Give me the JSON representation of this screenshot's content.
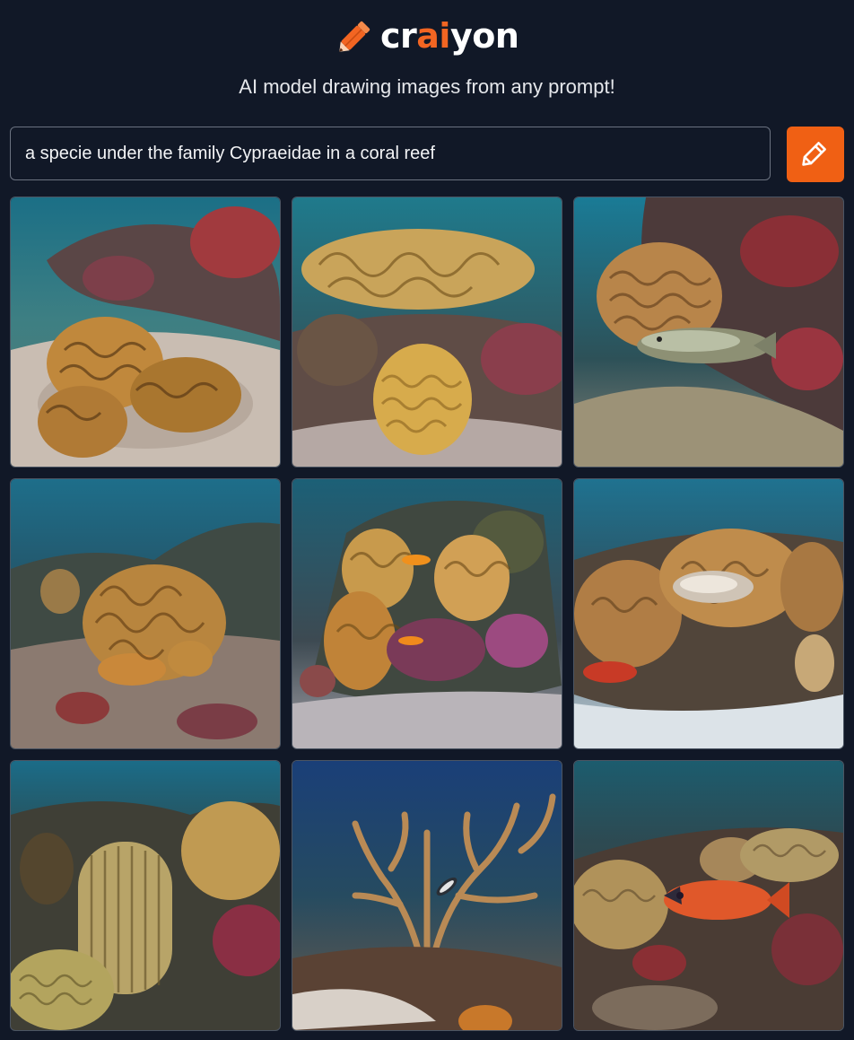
{
  "brand": {
    "name_prefix": "cr",
    "name_accent": "ai",
    "name_suffix": "yon",
    "accent_color": "#f26522",
    "logo_icon": "pencil-icon"
  },
  "tagline": "AI model drawing images from any prompt!",
  "prompt": {
    "value": "a specie under the family Cypraeidae in a coral reef"
  },
  "draw_button": {
    "icon": "pencil-icon",
    "color": "#f06014"
  },
  "results": {
    "count": 9,
    "images": [
      {
        "subject": "brain coral on sandy seafloor"
      },
      {
        "subject": "table coral above round coral"
      },
      {
        "subject": "reef with swimming fish"
      },
      {
        "subject": "lettuce coral colony"
      },
      {
        "subject": "coral with small orange fish"
      },
      {
        "subject": "coral reef with white cowrie"
      },
      {
        "subject": "tall ridged coral"
      },
      {
        "subject": "branching coral with fish"
      },
      {
        "subject": "reef with orange fish"
      }
    ]
  }
}
